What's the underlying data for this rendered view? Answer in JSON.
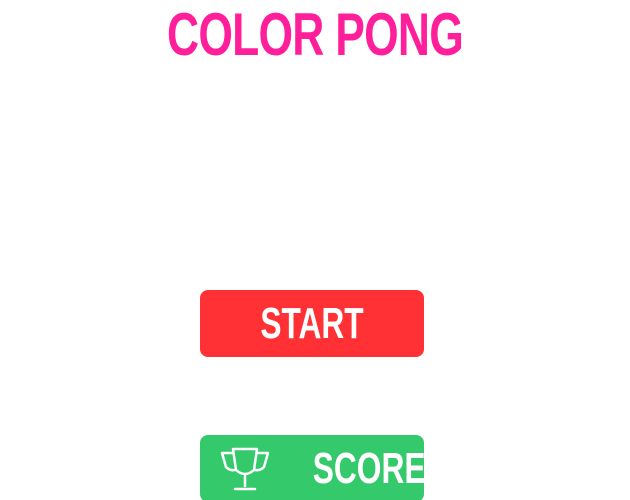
{
  "game": {
    "title": "COLOR PONG"
  },
  "menu": {
    "start_label": "START",
    "score_label": "SCORE",
    "score_icon": "trophy-icon"
  },
  "colors": {
    "title": "#ff1f9a",
    "start_button": "#ff3134",
    "score_button": "#34c96b",
    "button_text": "#ffffff",
    "background": "#ffffff"
  }
}
